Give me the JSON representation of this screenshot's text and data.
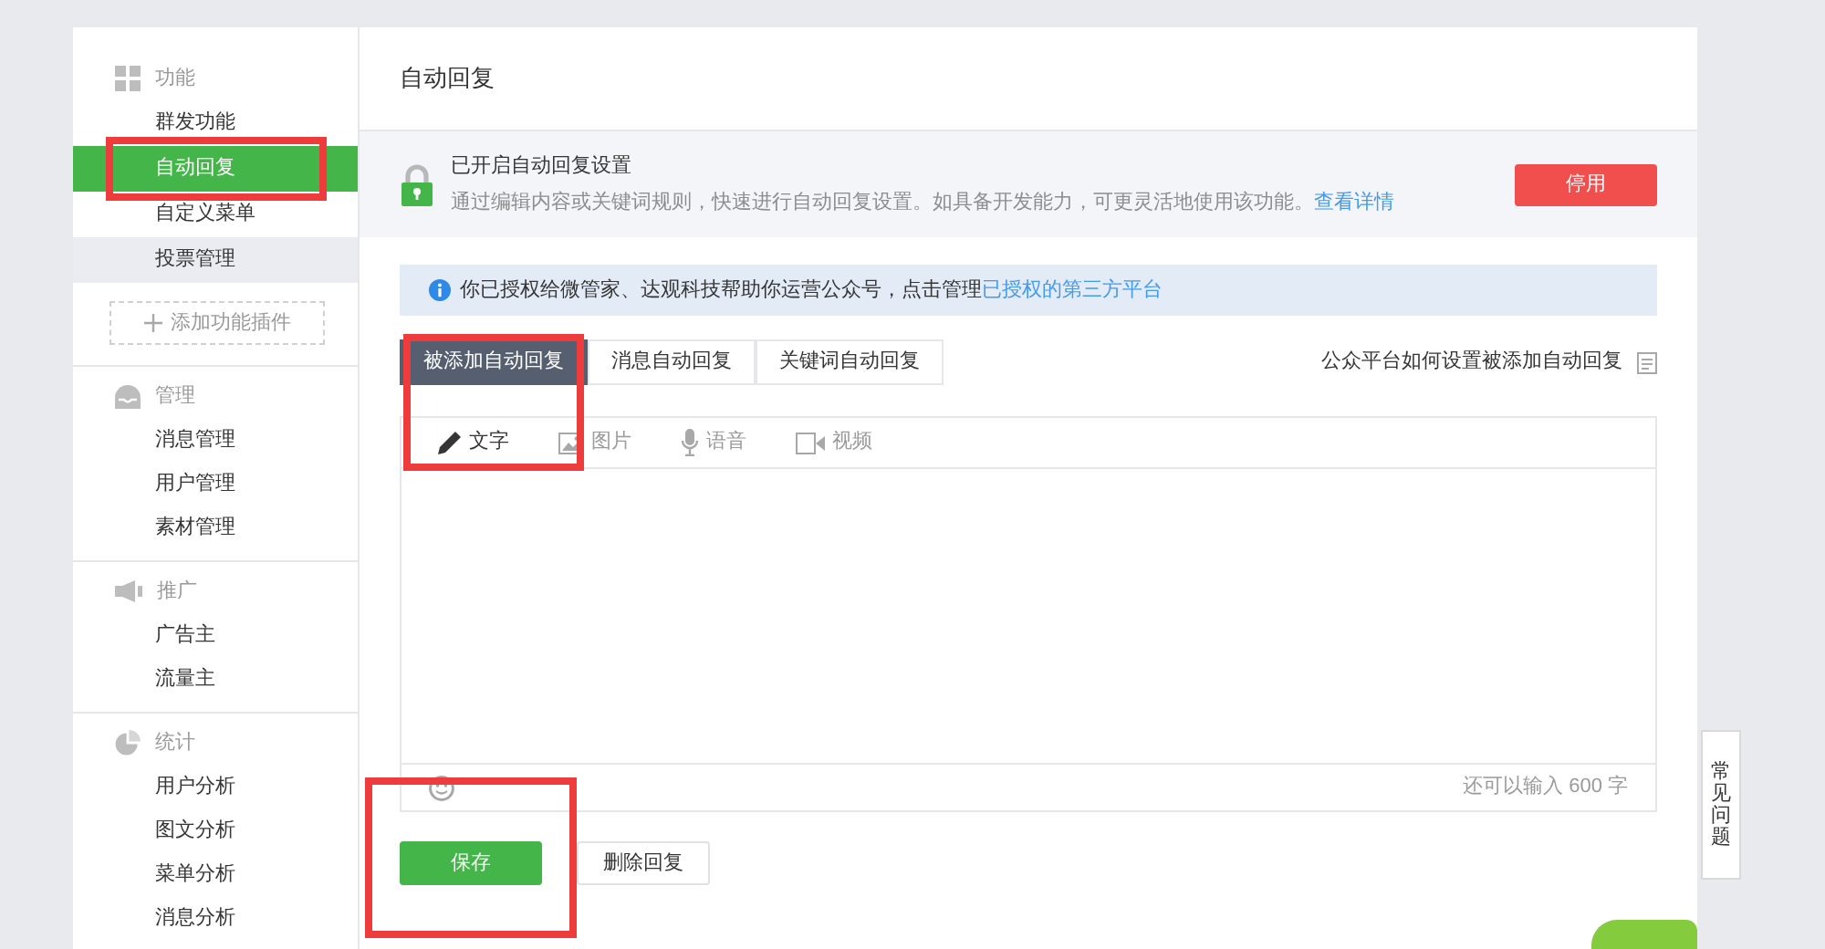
{
  "sidebar": {
    "sections": [
      {
        "title": "功能",
        "items": [
          {
            "label": "群发功能",
            "selected": false,
            "hovered": false,
            "annotated": false
          },
          {
            "label": "自动回复",
            "selected": true,
            "hovered": false,
            "annotated": true
          },
          {
            "label": "自定义菜单",
            "selected": false,
            "hovered": false,
            "annotated": false
          },
          {
            "label": "投票管理",
            "selected": false,
            "hovered": true,
            "annotated": false
          }
        ],
        "add_button": "添加功能插件"
      },
      {
        "title": "管理",
        "items": [
          {
            "label": "消息管理",
            "selected": false,
            "hovered": false,
            "annotated": false
          },
          {
            "label": "用户管理",
            "selected": false,
            "hovered": false,
            "annotated": false
          },
          {
            "label": "素材管理",
            "selected": false,
            "hovered": false,
            "annotated": false
          }
        ]
      },
      {
        "title": "推广",
        "items": [
          {
            "label": "广告主",
            "selected": false,
            "hovered": false,
            "annotated": false
          },
          {
            "label": "流量主",
            "selected": false,
            "hovered": false,
            "annotated": false
          }
        ]
      },
      {
        "title": "统计",
        "items": [
          {
            "label": "用户分析",
            "selected": false,
            "hovered": false,
            "annotated": false
          },
          {
            "label": "图文分析",
            "selected": false,
            "hovered": false,
            "annotated": false
          },
          {
            "label": "菜单分析",
            "selected": false,
            "hovered": false,
            "annotated": false
          },
          {
            "label": "消息分析",
            "selected": false,
            "hovered": false,
            "annotated": false
          }
        ]
      }
    ]
  },
  "header": {
    "title": "自动回复"
  },
  "status_panel": {
    "title": "已开启自动回复设置",
    "description": "通过编辑内容或关键词规则，快速进行自动回复设置。如具备开发能力，可更灵活地使用该功能。",
    "link": "查看详情",
    "button": "停用"
  },
  "notice": {
    "text": "你已授权给微管家、达观科技帮助你运营公众号，点击管理",
    "link": "已授权的第三方平台"
  },
  "reply_tabs": [
    {
      "label": "被添加自动回复",
      "selected": true,
      "annotated": true
    },
    {
      "label": "消息自动回复",
      "selected": false,
      "annotated": false
    },
    {
      "label": "关键词自动回复",
      "selected": false,
      "annotated": false
    }
  ],
  "help_link": "公众平台如何设置被添加自动回复",
  "editor": {
    "tools": [
      {
        "label": "文字",
        "selected": true
      },
      {
        "label": "图片",
        "selected": false
      },
      {
        "label": "语音",
        "selected": false
      },
      {
        "label": "视频",
        "selected": false
      }
    ],
    "counter": "还可以输入 600 字"
  },
  "actions": [
    {
      "label": "保存",
      "kind": "primary",
      "annotated": true
    },
    {
      "label": "删除回复",
      "kind": "secondary",
      "annotated": false
    }
  ],
  "side_tab": {
    "label": "常见问题"
  }
}
